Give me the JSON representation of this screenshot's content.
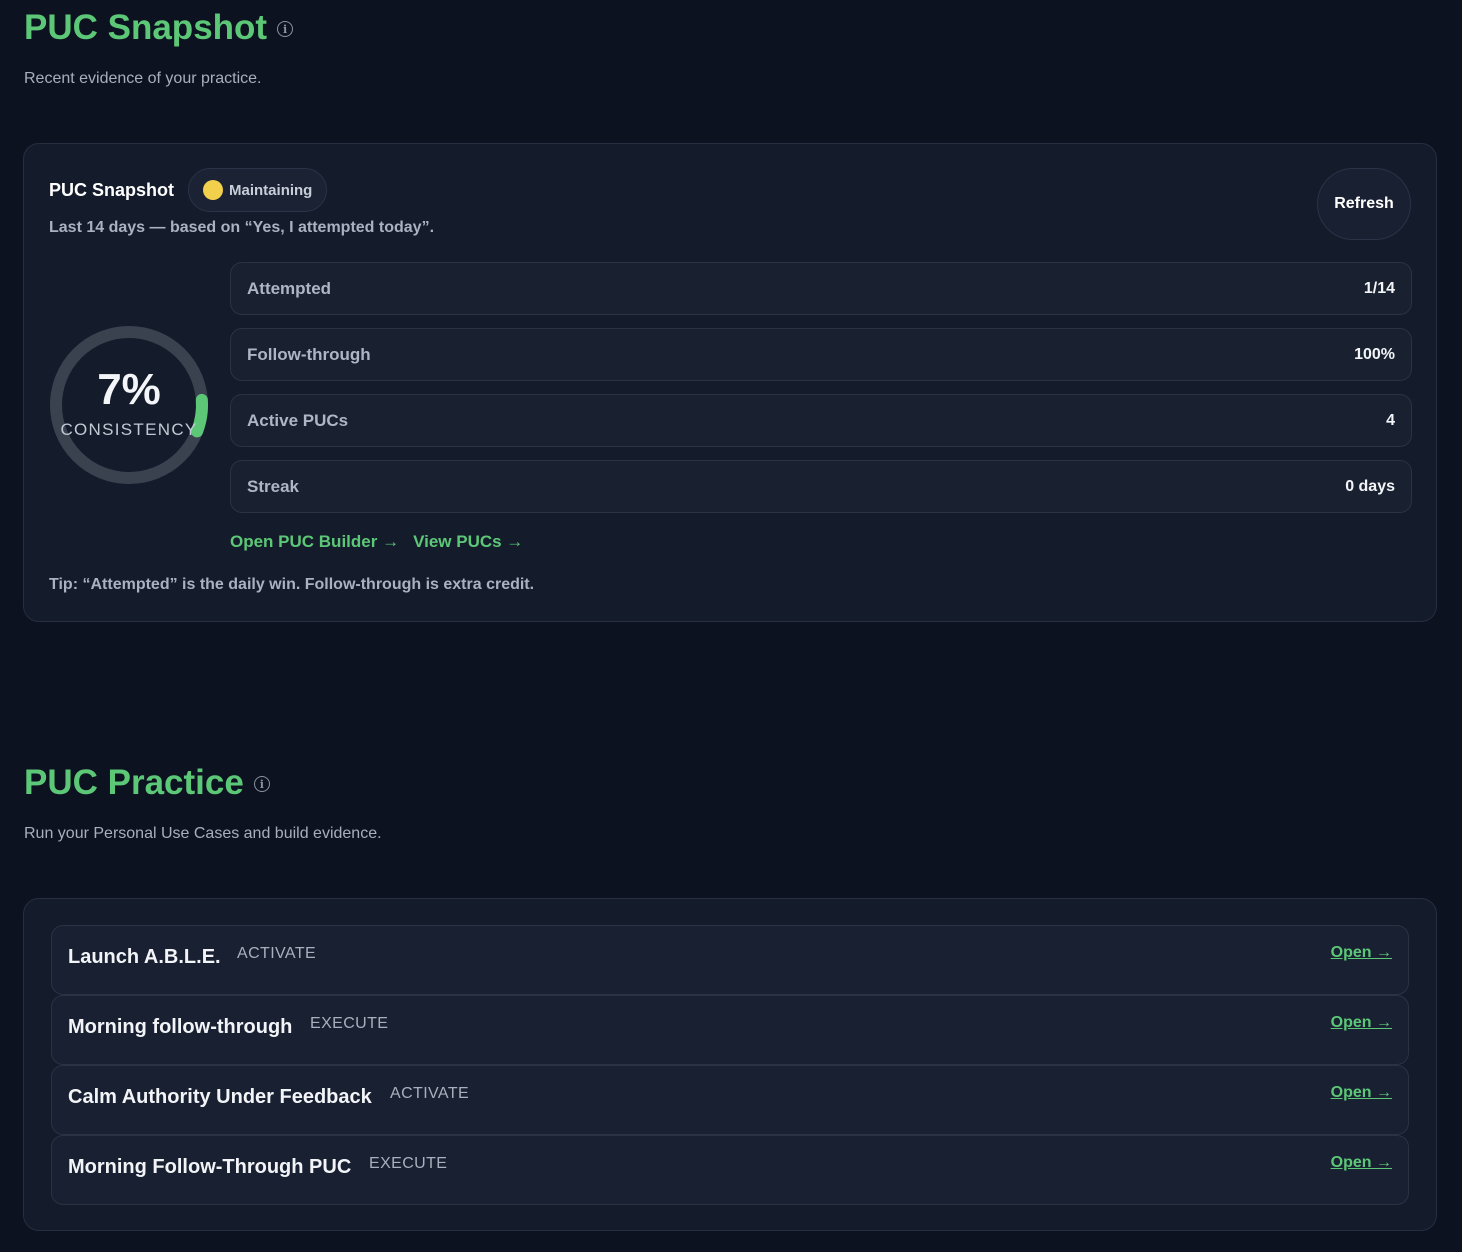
{
  "snapshot_section": {
    "title": "PUC Snapshot",
    "subtitle": "Recent evidence of your practice."
  },
  "snapshot_card": {
    "title": "PUC Snapshot",
    "status": {
      "label": "Maintaining",
      "color": "#f2d04b"
    },
    "subtitle": "Last 14 days — based on “Yes, I attempted today”.",
    "refresh_label": "Refresh",
    "consistency": {
      "percent_label": "7%",
      "label": "CONSISTENCY",
      "value": 0.07,
      "color": "#5cc877"
    },
    "stats": [
      {
        "label": "Attempted",
        "value": "1/14"
      },
      {
        "label": "Follow-through",
        "value": "100%"
      },
      {
        "label": "Active PUCs",
        "value": "4"
      },
      {
        "label": "Streak",
        "value": "0 days"
      }
    ],
    "links": {
      "builder": "Open PUC Builder →",
      "view": "View PUCs →"
    },
    "tip": "Tip: “Attempted” is the daily win. Follow-through is extra credit."
  },
  "practice_section": {
    "title": "PUC Practice",
    "subtitle": "Run your Personal Use Cases and build evidence."
  },
  "practice_items": [
    {
      "name": "Launch A.B.L.E.",
      "type": "ACTIVATE",
      "action": "Open →"
    },
    {
      "name": "Morning follow-through",
      "type": "EXECUTE",
      "action": "Open →"
    },
    {
      "name": "Calm Authority Under Feedback",
      "type": "ACTIVATE",
      "action": "Open →"
    },
    {
      "name": "Morning Follow-Through PUC",
      "type": "EXECUTE",
      "action": "Open →"
    }
  ],
  "theme": {
    "accent": "#5cc877",
    "background": "#0d1220",
    "card": "#141b2b"
  }
}
